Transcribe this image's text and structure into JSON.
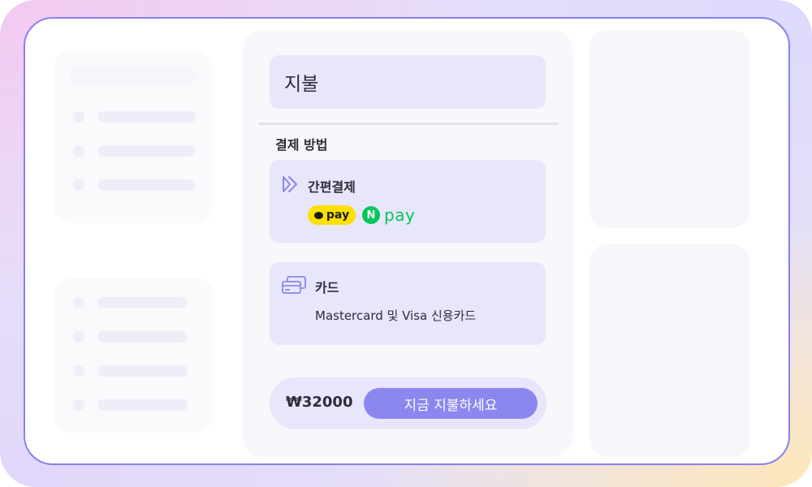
{
  "panel": {
    "title": "지불",
    "section_label": "결제 방법",
    "methods": [
      {
        "name": "간편결제",
        "icon": "fast-forward-icon",
        "providers": [
          {
            "label": "pay",
            "brand": "kakaopay",
            "color": "#fae100"
          },
          {
            "label": "pay",
            "badge": "N",
            "brand": "naverpay",
            "color": "#03c75a"
          }
        ]
      },
      {
        "name": "카드",
        "icon": "credit-card-icon",
        "description": "Mastercard 및 Visa 신용카드"
      }
    ],
    "total": "₩32000",
    "pay_button": "지금 지불하세요"
  },
  "colors": {
    "accent": "#8c86ef",
    "frame_border": "#8881ee",
    "card_bg": "#e8e6fb"
  }
}
